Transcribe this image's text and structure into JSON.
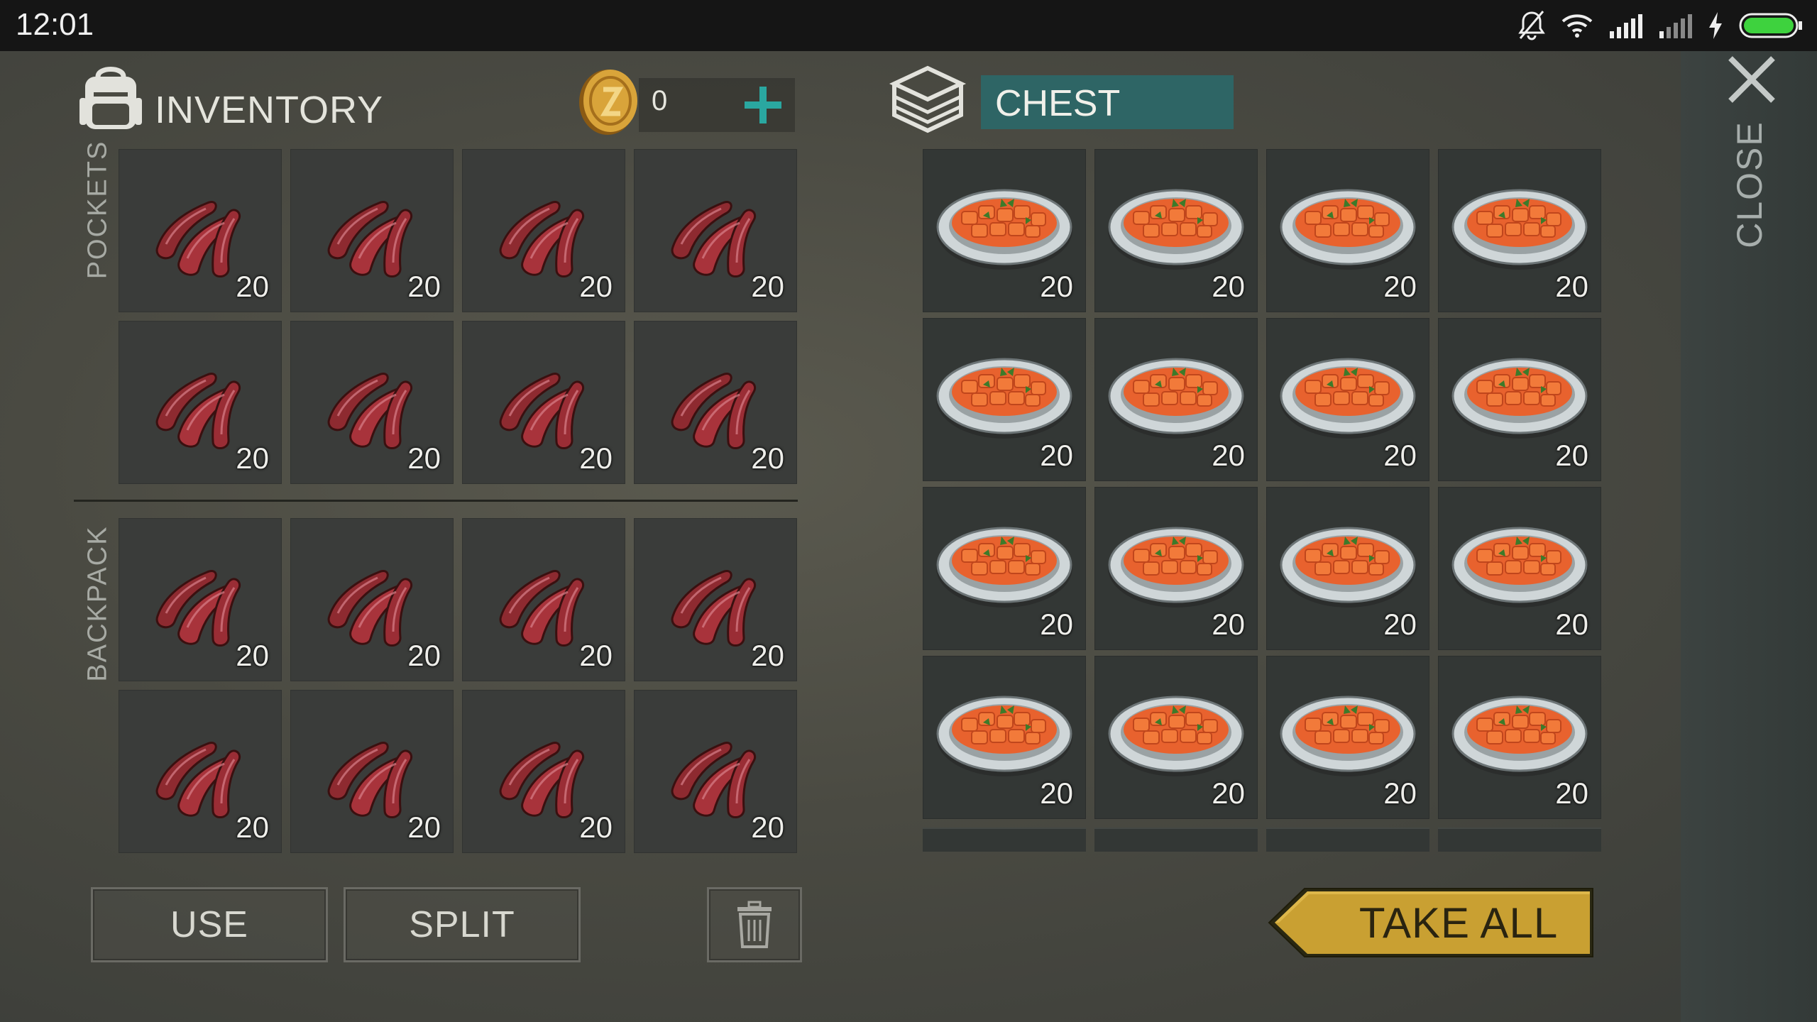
{
  "status_bar": {
    "time": "12:01",
    "icons": [
      "bell-muted-icon",
      "wifi-icon",
      "signal-icon",
      "signal-weak-icon",
      "charging-icon",
      "battery-icon"
    ]
  },
  "inventory": {
    "title": "INVENTORY",
    "coins": "0",
    "pockets_label": "POCKETS",
    "backpack_label": "BACKPACK",
    "pockets": [
      {
        "item": "raw-meat-icon",
        "qty": "20"
      },
      {
        "item": "raw-meat-icon",
        "qty": "20"
      },
      {
        "item": "raw-meat-icon",
        "qty": "20"
      },
      {
        "item": "raw-meat-icon",
        "qty": "20"
      },
      {
        "item": "raw-meat-icon",
        "qty": "20"
      },
      {
        "item": "raw-meat-icon",
        "qty": "20"
      },
      {
        "item": "raw-meat-icon",
        "qty": "20"
      },
      {
        "item": "raw-meat-icon",
        "qty": "20"
      }
    ],
    "backpack": [
      {
        "item": "raw-meat-icon",
        "qty": "20"
      },
      {
        "item": "raw-meat-icon",
        "qty": "20"
      },
      {
        "item": "raw-meat-icon",
        "qty": "20"
      },
      {
        "item": "raw-meat-icon",
        "qty": "20"
      },
      {
        "item": "raw-meat-icon",
        "qty": "20"
      },
      {
        "item": "raw-meat-icon",
        "qty": "20"
      },
      {
        "item": "raw-meat-icon",
        "qty": "20"
      },
      {
        "item": "raw-meat-icon",
        "qty": "20"
      }
    ]
  },
  "chest": {
    "title": "CHEST",
    "slots": [
      {
        "item": "stew-plate-icon",
        "qty": "20"
      },
      {
        "item": "stew-plate-icon",
        "qty": "20"
      },
      {
        "item": "stew-plate-icon",
        "qty": "20"
      },
      {
        "item": "stew-plate-icon",
        "qty": "20"
      },
      {
        "item": "stew-plate-icon",
        "qty": "20"
      },
      {
        "item": "stew-plate-icon",
        "qty": "20"
      },
      {
        "item": "stew-plate-icon",
        "qty": "20"
      },
      {
        "item": "stew-plate-icon",
        "qty": "20"
      },
      {
        "item": "stew-plate-icon",
        "qty": "20"
      },
      {
        "item": "stew-plate-icon",
        "qty": "20"
      },
      {
        "item": "stew-plate-icon",
        "qty": "20"
      },
      {
        "item": "stew-plate-icon",
        "qty": "20"
      },
      {
        "item": "stew-plate-icon",
        "qty": "20"
      },
      {
        "item": "stew-plate-icon",
        "qty": "20"
      },
      {
        "item": "stew-plate-icon",
        "qty": "20"
      },
      {
        "item": "stew-plate-icon",
        "qty": "20"
      }
    ]
  },
  "buttons": {
    "use": "USE",
    "split": "SPLIT",
    "take_all": "TAKE ALL",
    "close": "CLOSE"
  },
  "colors": {
    "chest_title_bg": "#2e6565",
    "take_all_bg": "#c9a032",
    "plus_accent": "#2aa7a0",
    "coin": "#c8912a"
  }
}
